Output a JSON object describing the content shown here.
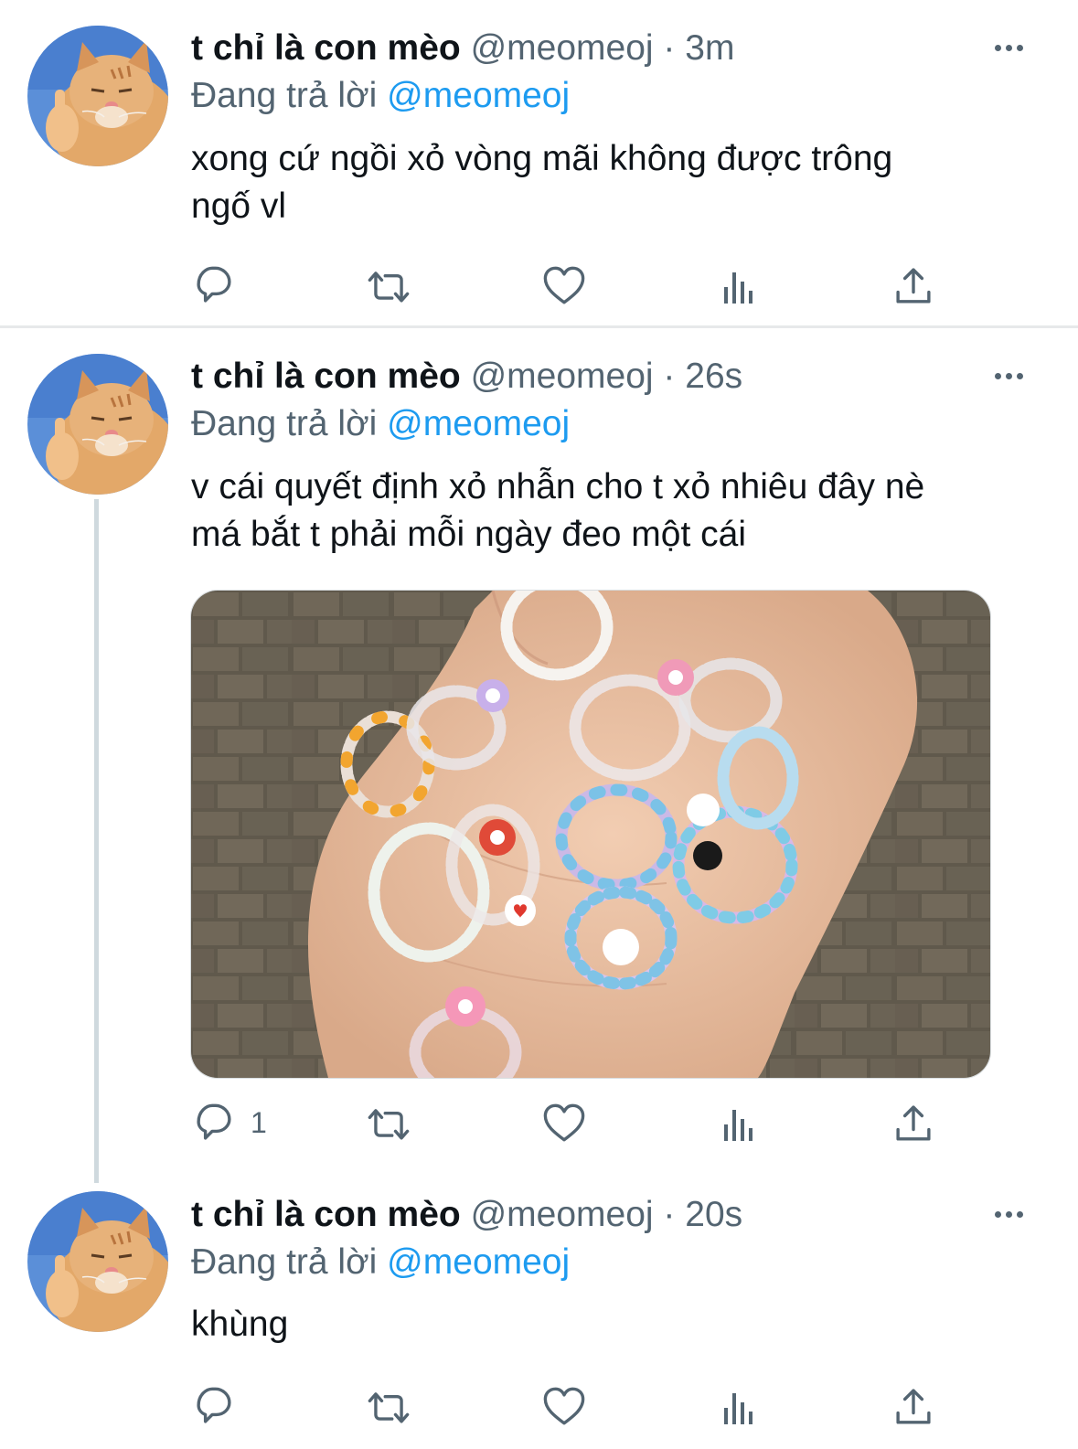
{
  "tweets": [
    {
      "name": "t chỉ là con mèo",
      "handle": "@meomeoj",
      "dot": "·",
      "time": "3m",
      "reply_prefix": "Đang trả lời",
      "reply_to": "@meomeoj",
      "text_line1": "xong cứ ngồi xỏ vòng mãi không được trông",
      "text_line2": "ngố vl",
      "reply_count": ""
    },
    {
      "name": "t chỉ là con mèo",
      "handle": "@meomeoj",
      "dot": "·",
      "time": "26s",
      "reply_prefix": "Đang trả lời",
      "reply_to": "@meomeoj",
      "text_line1": "v cái quyết định xỏ nhẫn cho t xỏ nhiêu đây nè",
      "text_line2": "má bắt t phải mỗi ngày đeo một cái",
      "reply_count": "1"
    },
    {
      "name": "t chỉ là con mèo",
      "handle": "@meomeoj",
      "dot": "·",
      "time": "20s",
      "reply_prefix": "Đang trả lời",
      "reply_to": "@meomeoj",
      "text_line1": "khùng",
      "text_line2": "",
      "reply_count": ""
    }
  ],
  "icons": {
    "avatar": "cat-avatar",
    "more": "more-icon",
    "reply": "reply-icon",
    "retweet": "retweet-icon",
    "like": "heart-icon",
    "analytics": "analytics-icon",
    "share": "share-icon"
  },
  "colors": {
    "text": "#0f1419",
    "secondary": "#536471",
    "accent": "#1d9bf0",
    "divider": "#e7e9ea"
  }
}
